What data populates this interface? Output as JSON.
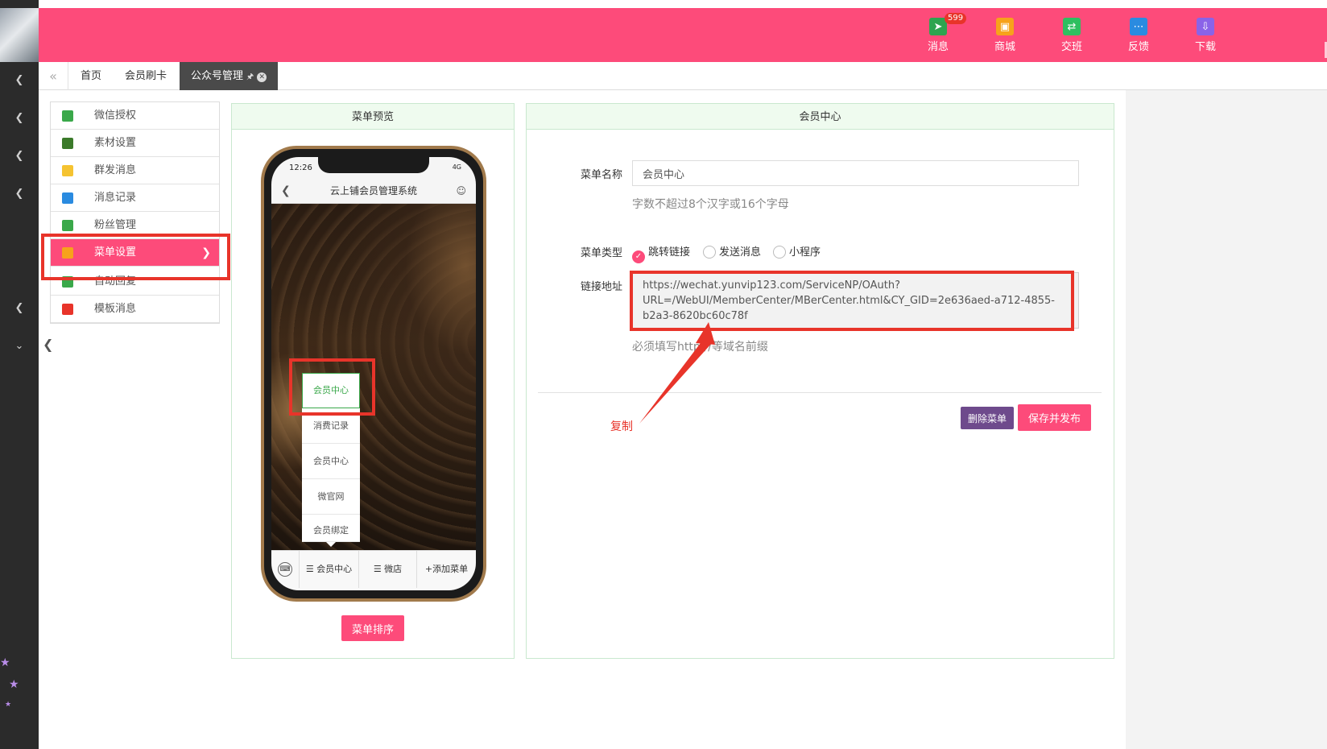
{
  "topbar": {
    "items": [
      {
        "label": "消息",
        "icon": "paper-plane-icon",
        "color": "#2ea44f",
        "badge": "599"
      },
      {
        "label": "商城",
        "icon": "shop-icon",
        "color": "#f7a21b"
      },
      {
        "label": "交班",
        "icon": "swap-icon",
        "color": "#2fbf60"
      },
      {
        "label": "反馈",
        "icon": "chat-icon",
        "color": "#2a8be0"
      },
      {
        "label": "下载",
        "icon": "download-icon",
        "color": "#8a63e8"
      }
    ]
  },
  "tabs": {
    "items": [
      {
        "label": "首页"
      },
      {
        "label": "会员刷卡"
      },
      {
        "label": "公众号管理"
      }
    ]
  },
  "submenu": {
    "items": [
      {
        "label": "微信授权",
        "icon": "wechat-icon",
        "color": "#3aa84a"
      },
      {
        "label": "素材设置",
        "icon": "image-icon",
        "color": "#3b7a2a"
      },
      {
        "label": "群发消息",
        "icon": "broadcast-icon",
        "color": "#f5c331"
      },
      {
        "label": "消息记录",
        "icon": "lock-icon",
        "color": "#2a8be0"
      },
      {
        "label": "粉丝管理",
        "icon": "bar-chart-icon",
        "color": "#3aa84a"
      },
      {
        "label": "菜单设置",
        "icon": "gear-icon",
        "color": "#f7a21b"
      },
      {
        "label": "自动回复",
        "icon": "reply-icon",
        "color": "#3aa84a"
      },
      {
        "label": "模板消息",
        "icon": "template-icon",
        "color": "#e8342a"
      }
    ]
  },
  "preview": {
    "title": "菜单预览",
    "phone": {
      "time": "12:26",
      "signal": "4G",
      "app_title": "云上铺会员管理系统",
      "popup_items": [
        "会员中心",
        "消费记录",
        "会员中心",
        "微官网",
        "会员绑定"
      ],
      "menu_bar": [
        "会员中心",
        "微店",
        "+添加菜单"
      ]
    },
    "sort_label": "菜单排序"
  },
  "editor": {
    "title": "会员中心",
    "name_label": "菜单名称",
    "name_value": "会员中心",
    "name_hint": "字数不超过8个汉字或16个字母",
    "type_label": "菜单类型",
    "type_options": [
      "跳转链接",
      "发送消息",
      "小程序"
    ],
    "type_selected": "跳转链接",
    "url_label": "链接地址",
    "url_value": "https://wechat.yunvip123.com/ServiceNP/OAuth?URL=/WebUI/MemberCenter/MBerCenter.html&CY_GID=2e636aed-a712-4855-b2a3-8620bc60c78f",
    "url_hint": "必须填写http://等域名前缀",
    "delete_label": "删除菜单",
    "save_label": "保存并发布",
    "annotation": "复制"
  }
}
